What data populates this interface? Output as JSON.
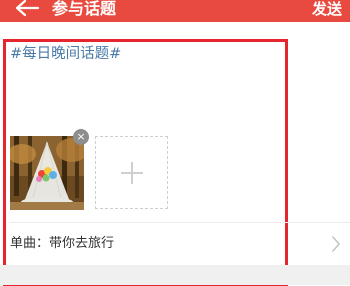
{
  "header": {
    "title": "参与话题",
    "send_label": "发送",
    "back_icon": "arrow-left-icon",
    "background_color": "#e94a3f"
  },
  "topic": {
    "text": "#每日晚间话题#",
    "color": "#4a7aa8"
  },
  "attachments": {
    "photo_icon": "photo-thumbnail",
    "remove_icon": "close-icon",
    "remove_glyph": "×",
    "add_icon": "plus-icon"
  },
  "song": {
    "label": "单曲：带你去旅行",
    "chevron_icon": "chevron-right-icon"
  },
  "highlight_color": "#e5262f"
}
